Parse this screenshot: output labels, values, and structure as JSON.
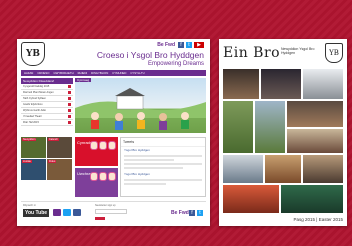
{
  "website": {
    "logo_text": "YB",
    "social_label": "Be Fwd",
    "title": "Croeso i Ysgol Bro Hyddgen",
    "subtitle": "Empowering Dreams",
    "nav": [
      "HAFAN",
      "CROESO",
      "GWYBODAETH",
      "RHIENI",
      "DISGYBLION",
      "CYMUNED",
      "CYSYLLTU"
    ],
    "sidebar_header": "Newyddion Diweddaraf",
    "sidebar_items": [
      "Cyngerdd Nadolig 2015",
      "Diwrnod Plant Mewn Angen",
      "Taith Cyfnod Sylfaen",
      "Gwobr Efydd Eco",
      "Wythnos Gwrth-fwlio",
      "Ymweliad Theatr",
      "Ffair Haf 2015"
    ],
    "hero_label": "Cymraeg",
    "tiles": [
      {
        "label": "Newyddion",
        "color": "#556b2f"
      },
      {
        "label": "Calendr",
        "color": "#5a4a3a"
      },
      {
        "label": "Lluniau",
        "color": "#2f4f6f"
      },
      {
        "label": "Fideo",
        "color": "#7a5a3a"
      }
    ],
    "panel_red_label": "Cynradd",
    "panel_purple_label": "Uwchradd",
    "fb_header": "Tweets",
    "fb_account": "Ysgol Bro Hyddgen",
    "footer_youtube": "You Tube",
    "footer_links": "Dilynwch ni",
    "footer_subscribe": "Newsletter sign up",
    "colors": {
      "primary": "#6a2d8f",
      "accent": "#cc1f3b"
    }
  },
  "newsletter": {
    "title": "Ein Bro",
    "subtitle": "Newyddion Ysgol Bro Hyddgen",
    "logo_text": "YB",
    "issue": "Pasg 2015 | Easter 2015"
  },
  "background_color": "#b01430"
}
